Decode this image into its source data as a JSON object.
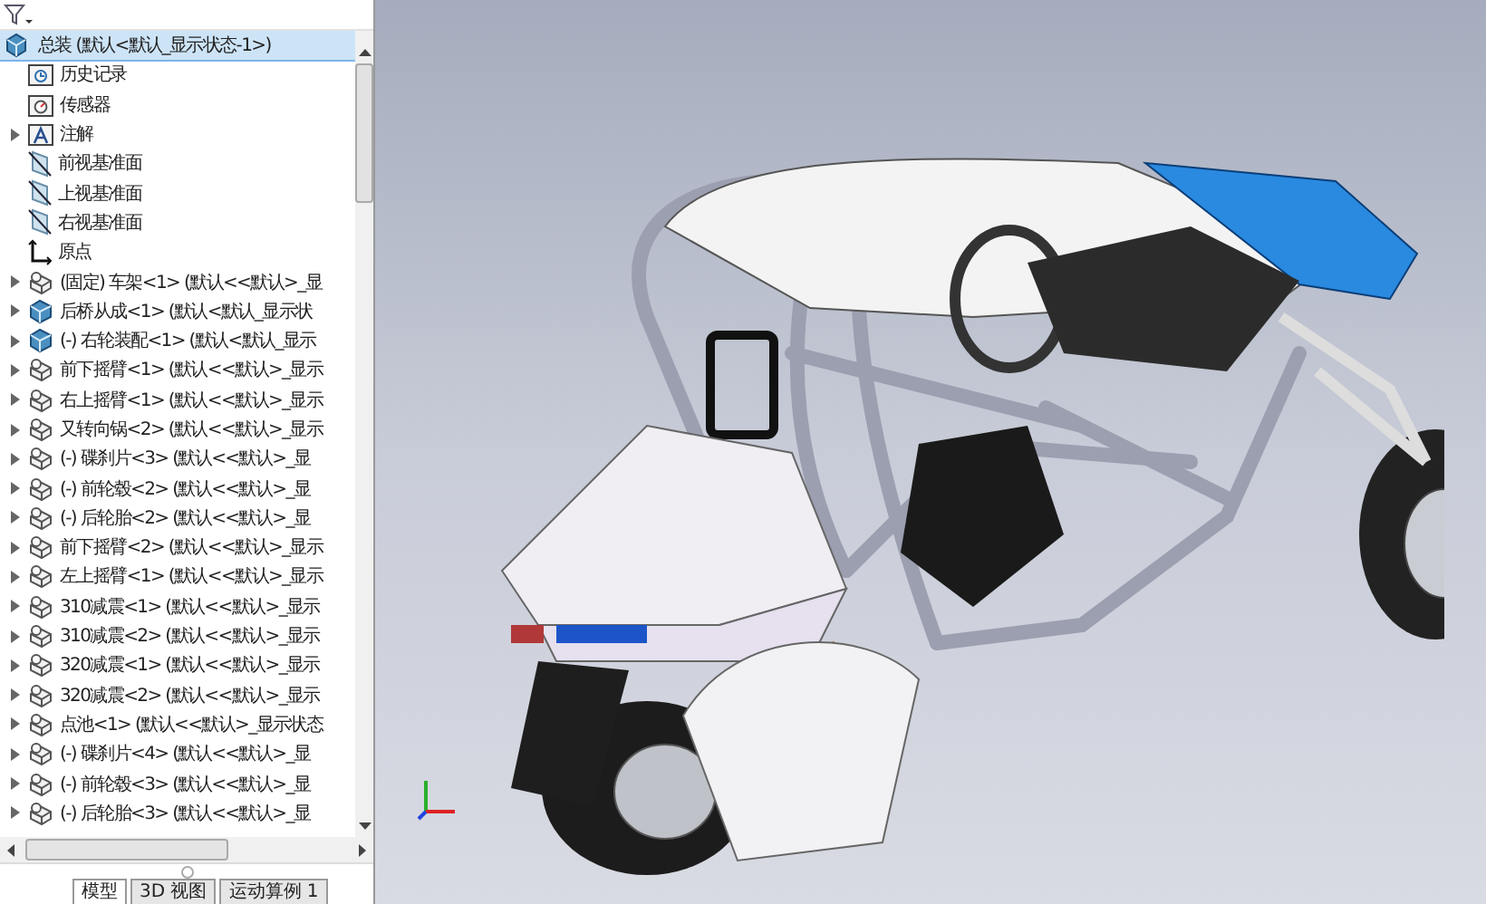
{
  "tree": {
    "root": {
      "label": "总装 (默认<默认_显示状态-1>)",
      "selected": true
    },
    "items": [
      {
        "kind": "history",
        "label": "历史记录",
        "expandable": false
      },
      {
        "kind": "sensor",
        "label": "传感器",
        "expandable": false
      },
      {
        "kind": "annotation",
        "label": "注解",
        "expandable": true
      },
      {
        "kind": "plane",
        "label": "前视基准面",
        "expandable": false
      },
      {
        "kind": "plane",
        "label": "上视基准面",
        "expandable": false
      },
      {
        "kind": "plane",
        "label": "右视基准面",
        "expandable": false
      },
      {
        "kind": "origin",
        "label": "原点",
        "expandable": false
      },
      {
        "kind": "part",
        "label": "(固定) 车架<1> (默认<<默认>_显",
        "expandable": true
      },
      {
        "kind": "assembly",
        "label": "后桥从成<1> (默认<默认_显示状",
        "expandable": true
      },
      {
        "kind": "assembly",
        "label": "(-) 右轮装配<1> (默认<默认_显示",
        "expandable": true
      },
      {
        "kind": "part",
        "label": "前下摇臂<1> (默认<<默认>_显示",
        "expandable": true
      },
      {
        "kind": "part",
        "label": "右上摇臂<1> (默认<<默认>_显示",
        "expandable": true
      },
      {
        "kind": "part",
        "label": "又转向锅<2> (默认<<默认>_显示",
        "expandable": true
      },
      {
        "kind": "part",
        "label": "(-) 碟刹片<3> (默认<<默认>_显",
        "expandable": true
      },
      {
        "kind": "part",
        "label": "(-) 前轮毂<2> (默认<<默认>_显",
        "expandable": true
      },
      {
        "kind": "part",
        "label": "(-) 后轮胎<2> (默认<<默认>_显",
        "expandable": true
      },
      {
        "kind": "part",
        "label": "前下摇臂<2> (默认<<默认>_显示",
        "expandable": true
      },
      {
        "kind": "part",
        "label": "左上摇臂<1> (默认<<默认>_显示",
        "expandable": true
      },
      {
        "kind": "part",
        "label": "310减震<1> (默认<<默认>_显示",
        "expandable": true
      },
      {
        "kind": "part",
        "label": "310减震<2> (默认<<默认>_显示",
        "expandable": true
      },
      {
        "kind": "part",
        "label": "320减震<1> (默认<<默认>_显示",
        "expandable": true
      },
      {
        "kind": "part",
        "label": "320减震<2> (默认<<默认>_显示",
        "expandable": true
      },
      {
        "kind": "part",
        "label": "点池<1> (默认<<默认>_显示状态",
        "expandable": true
      },
      {
        "kind": "part",
        "label": "(-) 碟刹片<4> (默认<<默认>_显",
        "expandable": true
      },
      {
        "kind": "part",
        "label": "(-) 前轮毂<3> (默认<<默认>_显",
        "expandable": true
      },
      {
        "kind": "part",
        "label": "(-) 后轮胎<3> (默认<<默认>_显",
        "expandable": true
      }
    ]
  },
  "tabs": [
    {
      "label": "模型",
      "selected": true
    },
    {
      "label": "3D 视图",
      "selected": false
    },
    {
      "label": "运动算例 1",
      "selected": false
    }
  ]
}
